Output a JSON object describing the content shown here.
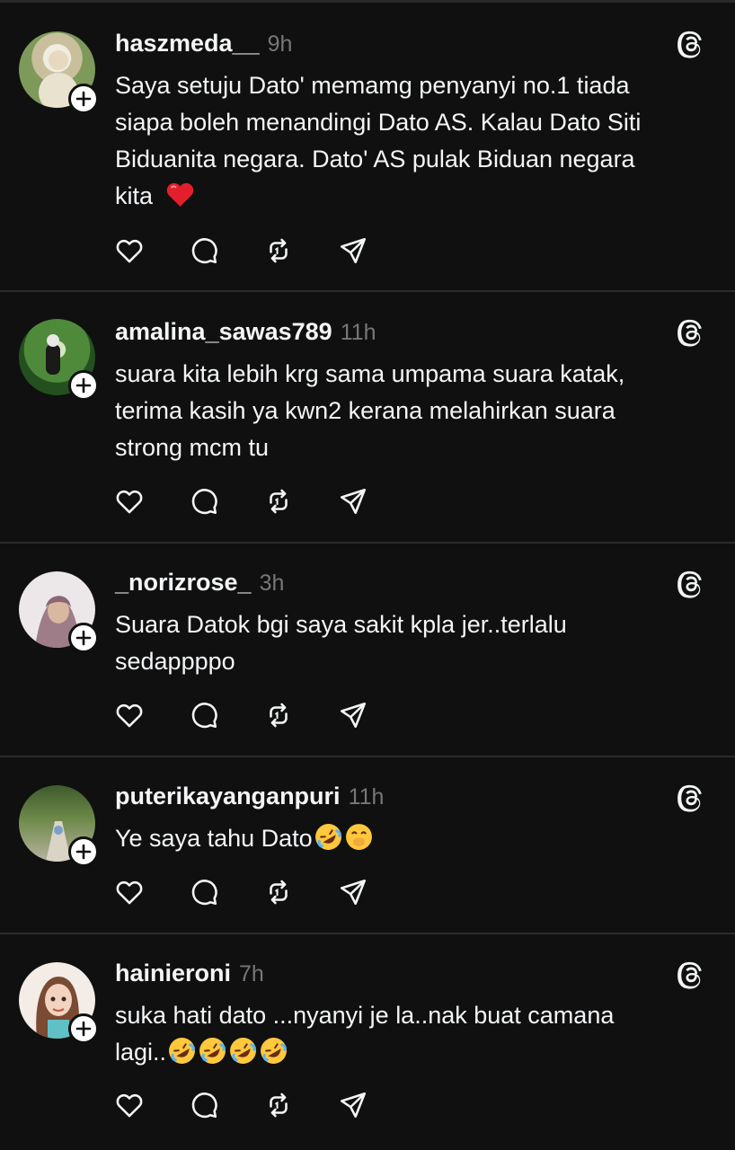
{
  "posts": [
    {
      "username": "haszmeda__",
      "time": "9h",
      "text": "Saya setuju Dato'  memamg penyanyi no.1 tiada\nsiapa boleh menandingi Dato AS. Kalau Dato Siti\nBiduanita negara. Dato' AS pulak Biduan negara\nkita",
      "emoji": [
        "red-heart"
      ],
      "avatar_colors": [
        "#d7d2a8",
        "#8fa06a"
      ]
    },
    {
      "username": "amalina_sawas789",
      "time": "11h",
      "text": "suara kita lebih krg sama umpama suara katak,\nterima kasih ya kwn2 kerana melahirkan suara\nstrong mcm tu",
      "emoji": [],
      "avatar_colors": [
        "#2f6b2a",
        "#9cc46a"
      ]
    },
    {
      "username": "_norizrose_",
      "time": "3h",
      "text": "Suara Datok bgi saya sakit kpla jer..terlalu\nsedappppo",
      "emoji": [],
      "avatar_colors": [
        "#e9e4e6",
        "#a07a86"
      ]
    },
    {
      "username": "puterikayanganpuri",
      "time": "11h",
      "text": "Ye saya tahu Dato",
      "emoji": [
        "rofl",
        "hand-over-mouth"
      ],
      "avatar_colors": [
        "#556b3a",
        "#c9c2b0"
      ]
    },
    {
      "username": "hainieroni",
      "time": "7h",
      "text": "suka hati dato ...nyanyi je la..nak buat camana\nlagi..",
      "emoji": [
        "rofl",
        "rofl",
        "rofl",
        "rofl"
      ],
      "avatar_colors": [
        "#f2e6dc",
        "#7a4a32"
      ]
    }
  ],
  "icons": {
    "like": "heart-icon",
    "reply": "comment-icon",
    "repost": "repost-icon",
    "share": "send-icon",
    "app": "threads-icon",
    "follow": "plus-icon"
  },
  "colors": {
    "background": "#101010",
    "text": "#f3f5f7",
    "muted": "#777777",
    "divider": "#2b2b2b"
  }
}
